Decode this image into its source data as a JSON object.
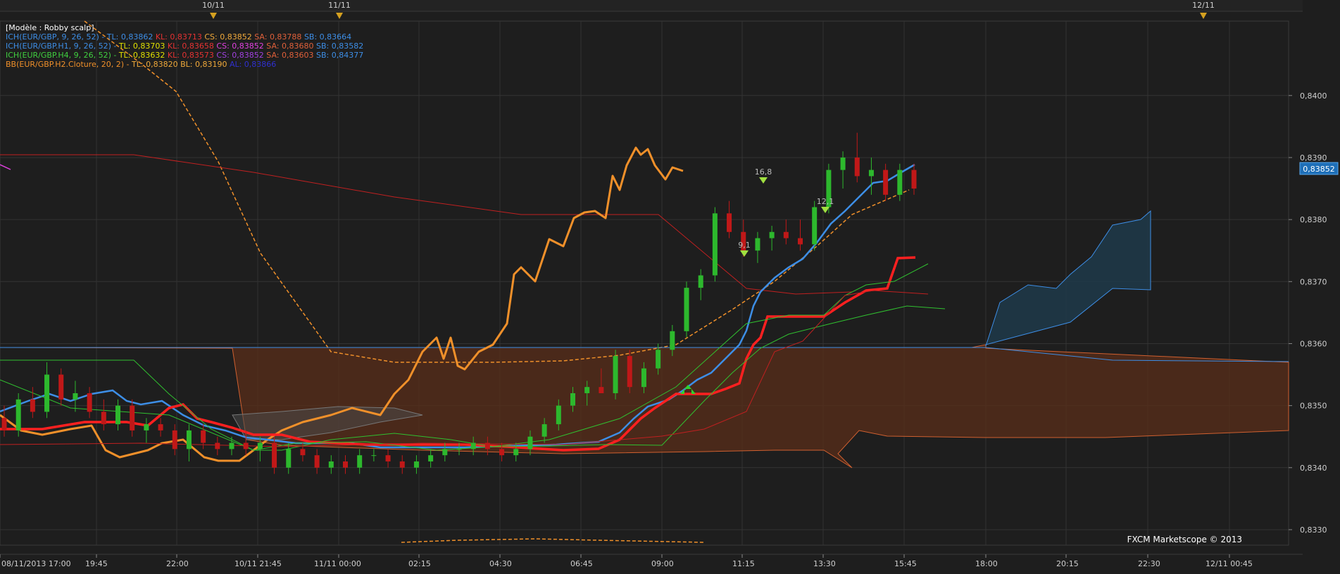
{
  "chart_data": {
    "type": "line",
    "title": "[Modèle : Robby scalp]",
    "legend": [
      {
        "text": "ICH(EUR/GBP, 9, 26, 52) -",
        "color": "#3d8ee6",
        "parts": [
          {
            "t": "TL: 0,83862",
            "c": "#3d8ee6"
          },
          {
            "t": "KL: 0,83713",
            "c": "#e53232"
          },
          {
            "t": "CS: 0,83852",
            "c": "#f0a93a"
          },
          {
            "t": "SA: 0,83788",
            "c": "#e0603a"
          },
          {
            "t": "SB: 0,83664",
            "c": "#3d8ee6"
          }
        ]
      },
      {
        "text": "ICH(EUR/GBP.H1, 9, 26, 52) -",
        "color": "#3d8ee6",
        "parts": [
          {
            "t": "TL: 0,83703",
            "c": "#e0e000"
          },
          {
            "t": "KL: 0,83658",
            "c": "#e53232"
          },
          {
            "t": "CS: 0,83852",
            "c": "#e040e0"
          },
          {
            "t": "SA: 0,83680",
            "c": "#e0603a"
          },
          {
            "t": "SB: 0,83582",
            "c": "#3d8ee6"
          }
        ]
      },
      {
        "text": "ICH(EUR/GBP.H4, 9, 26, 52) -",
        "color": "#40d040",
        "parts": [
          {
            "t": "TL: 0,83632",
            "c": "#e0e000"
          },
          {
            "t": "KL: 0,83573",
            "c": "#e53232"
          },
          {
            "t": "CS: 0,83852",
            "c": "#a040e0"
          },
          {
            "t": "SA: 0,83603",
            "c": "#e0603a"
          },
          {
            "t": "SB: 0,84377",
            "c": "#3d8ee6"
          }
        ]
      },
      {
        "text": "BB(EUR/GBP.H2.Cloture, 20, 2) -",
        "color": "#f0902a",
        "parts": [
          {
            "t": "TL: 0,83820",
            "c": "#f0a93a"
          },
          {
            "t": "BL: 0,83190",
            "c": "#f0a93a"
          },
          {
            "t": "AL: 0,83866",
            "c": "#3030d0"
          }
        ]
      }
    ],
    "y_ticks": [
      "0,8400",
      "0,8390",
      "0,8380",
      "0,8370",
      "0,8360",
      "0,8350",
      "0,8340",
      "0,8330"
    ],
    "y_tick_values": [
      0.84,
      0.839,
      0.838,
      0.837,
      0.836,
      0.835,
      0.834,
      0.833
    ],
    "ylim": [
      0.83275,
      0.8412
    ],
    "current_price": "0,83852",
    "current_price_value": 0.83852,
    "x_labels": [
      "08/11/2013 17:00",
      "19:45",
      "22:00",
      "10/11 21:45",
      "11/11 00:00",
      "02:15",
      "04:30",
      "06:45",
      "09:00",
      "11:15",
      "13:30",
      "15:45",
      "18:00",
      "20:15",
      "22:30",
      "12/11 00:45"
    ],
    "top_markers": [
      "10/11",
      "11/11",
      "12/11"
    ],
    "signals": [
      "9,1",
      "16,8",
      "12,1"
    ],
    "watermark": "FXCM Marketscope © 2013",
    "colors": {
      "bg": "#1e1e1e",
      "grid": "#333333",
      "up": "#2db82d",
      "down": "#c01818",
      "orange": "#f0902a",
      "blue": "#3d8ee6",
      "red": "#ff2020"
    },
    "candles": [
      [
        0.8348,
        0.835,
        0.8345,
        0.8346
      ],
      [
        0.8346,
        0.8352,
        0.8345,
        0.8351
      ],
      [
        0.8351,
        0.8353,
        0.8348,
        0.8349
      ],
      [
        0.8349,
        0.8357,
        0.8348,
        0.8355
      ],
      [
        0.8355,
        0.8356,
        0.835,
        0.8351
      ],
      [
        0.8351,
        0.8354,
        0.8349,
        0.8352
      ],
      [
        0.8352,
        0.8353,
        0.8348,
        0.8349
      ],
      [
        0.8349,
        0.8351,
        0.8346,
        0.8347
      ],
      [
        0.8347,
        0.8351,
        0.8346,
        0.835
      ],
      [
        0.835,
        0.8351,
        0.8345,
        0.8346
      ],
      [
        0.8346,
        0.8348,
        0.8344,
        0.8347
      ],
      [
        0.8347,
        0.8348,
        0.8345,
        0.8346
      ],
      [
        0.8346,
        0.8347,
        0.8342,
        0.8343
      ],
      [
        0.8343,
        0.8347,
        0.8341,
        0.8346
      ],
      [
        0.8346,
        0.8347,
        0.8343,
        0.8344
      ],
      [
        0.8344,
        0.8345,
        0.8342,
        0.8343
      ],
      [
        0.8343,
        0.8345,
        0.8342,
        0.8344
      ],
      [
        0.8344,
        0.8346,
        0.8342,
        0.8343
      ],
      [
        0.8343,
        0.8345,
        0.8341,
        0.8344
      ],
      [
        0.8344,
        0.8345,
        0.8339,
        0.834
      ],
      [
        0.834,
        0.8344,
        0.8339,
        0.8343
      ],
      [
        0.8343,
        0.8344,
        0.8341,
        0.8342
      ],
      [
        0.8342,
        0.8343,
        0.8339,
        0.834
      ],
      [
        0.834,
        0.8342,
        0.8339,
        0.8341
      ],
      [
        0.8341,
        0.8342,
        0.8339,
        0.834
      ],
      [
        0.834,
        0.8343,
        0.8339,
        0.8342
      ],
      [
        0.8342,
        0.8343,
        0.8341,
        0.8342
      ],
      [
        0.8342,
        0.8343,
        0.834,
        0.8341
      ],
      [
        0.8341,
        0.8342,
        0.8339,
        0.834
      ],
      [
        0.834,
        0.8342,
        0.8339,
        0.8341
      ],
      [
        0.8341,
        0.8343,
        0.834,
        0.8342
      ],
      [
        0.8342,
        0.8344,
        0.8341,
        0.8343
      ],
      [
        0.8343,
        0.8344,
        0.8342,
        0.8343
      ],
      [
        0.8343,
        0.8345,
        0.8342,
        0.8344
      ],
      [
        0.8344,
        0.8345,
        0.8342,
        0.8343
      ],
      [
        0.8343,
        0.8344,
        0.8341,
        0.8342
      ],
      [
        0.8342,
        0.8344,
        0.8341,
        0.8343
      ],
      [
        0.8343,
        0.8346,
        0.8342,
        0.8345
      ],
      [
        0.8345,
        0.8348,
        0.8344,
        0.8347
      ],
      [
        0.8347,
        0.8351,
        0.8346,
        0.835
      ],
      [
        0.835,
        0.8353,
        0.8349,
        0.8352
      ],
      [
        0.8352,
        0.8354,
        0.835,
        0.8353
      ],
      [
        0.8353,
        0.8356,
        0.8352,
        0.8352
      ],
      [
        0.8352,
        0.8359,
        0.8351,
        0.8358
      ],
      [
        0.8358,
        0.8359,
        0.8352,
        0.8353
      ],
      [
        0.8353,
        0.8357,
        0.8352,
        0.8356
      ],
      [
        0.8356,
        0.836,
        0.8355,
        0.8359
      ],
      [
        0.8359,
        0.8363,
        0.8358,
        0.8362
      ],
      [
        0.8362,
        0.837,
        0.8361,
        0.8369
      ],
      [
        0.8369,
        0.8372,
        0.8367,
        0.8371
      ],
      [
        0.8371,
        0.8382,
        0.837,
        0.8381
      ],
      [
        0.8381,
        0.8383,
        0.8377,
        0.8378
      ],
      [
        0.8378,
        0.838,
        0.8374,
        0.8375
      ],
      [
        0.8375,
        0.8378,
        0.8373,
        0.8377
      ],
      [
        0.8377,
        0.8379,
        0.8375,
        0.8378
      ],
      [
        0.8378,
        0.838,
        0.8376,
        0.8377
      ],
      [
        0.8377,
        0.838,
        0.8375,
        0.8376
      ],
      [
        0.8376,
        0.8383,
        0.8375,
        0.8382
      ],
      [
        0.8382,
        0.8389,
        0.8381,
        0.8388
      ],
      [
        0.8388,
        0.8391,
        0.8385,
        0.839
      ],
      [
        0.839,
        0.8394,
        0.8386,
        0.8387
      ],
      [
        0.8387,
        0.839,
        0.8384,
        0.8388
      ],
      [
        0.8388,
        0.8389,
        0.8383,
        0.8384
      ],
      [
        0.8384,
        0.8389,
        0.8383,
        0.8388
      ],
      [
        0.8388,
        0.8389,
        0.8384,
        0.8385
      ]
    ],
    "candle_x_start": 6,
    "candle_x_end": 1298,
    "candle_index_range": [
      0,
      64
    ]
  }
}
